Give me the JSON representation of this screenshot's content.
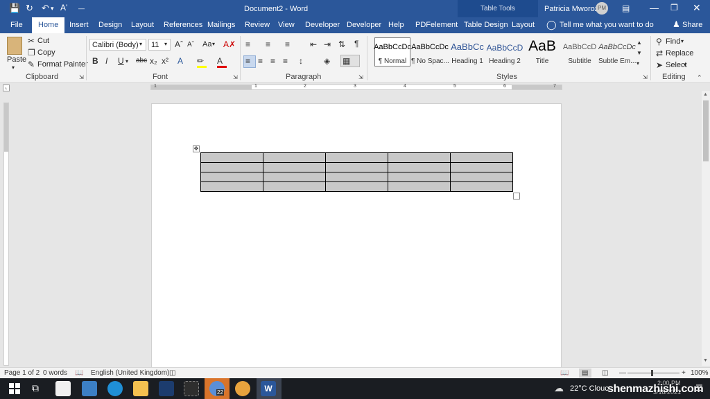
{
  "title_bar": {
    "document_title": "Document2 - Word",
    "context_label": "Table Tools",
    "user_name": "Patricia Mworozi",
    "user_initials": "PM"
  },
  "tabs": [
    "File",
    "Home",
    "Insert",
    "Design",
    "Layout",
    "References",
    "Mailings",
    "Review",
    "View",
    "Developer",
    "Developer",
    "Help",
    "PDFelement",
    "Table Design",
    "Layout"
  ],
  "active_tab": "Home",
  "tell_me": "Tell me what you want to do",
  "share_label": "Share",
  "clipboard": {
    "paste": "Paste",
    "cut": "Cut",
    "copy": "Copy",
    "format_painter": "Format Painter",
    "group_label": "Clipboard"
  },
  "font": {
    "name": "Calibri (Body)",
    "size": "11",
    "case_label": "Aa",
    "group_label": "Font"
  },
  "paragraph": {
    "group_label": "Paragraph"
  },
  "styles": {
    "items": [
      {
        "sample": "AaBbCcDc",
        "name": "¶ Normal"
      },
      {
        "sample": "AaBbCcDc",
        "name": "¶ No Spac..."
      },
      {
        "sample": "AaBbCc",
        "name": "Heading 1"
      },
      {
        "sample": "AaBbCcD",
        "name": "Heading 2"
      },
      {
        "sample": "AaB",
        "name": "Title"
      },
      {
        "sample": "AaBbCcD",
        "name": "Subtitle"
      },
      {
        "sample": "AaBbCcDc",
        "name": "Subtle Em..."
      }
    ],
    "group_label": "Styles"
  },
  "editing": {
    "find": "Find",
    "replace": "Replace",
    "select": "Select",
    "group_label": "Editing"
  },
  "ruler_numbers": [
    "1",
    "1",
    "2",
    "3",
    "4",
    "5",
    "6",
    "7"
  ],
  "table": {
    "rows": 4,
    "columns": 5
  },
  "status_bar": {
    "page": "Page 1 of 2",
    "words": "0 words",
    "language": "English (United Kingdom)",
    "zoom": "100%"
  },
  "taskbar": {
    "weather": "22°C  Clouc",
    "time": "2:00 PM",
    "date": "3/18/2021",
    "badge": "22",
    "watermark": "shenmazhishi.com"
  },
  "colors": {
    "word_blue": "#2b579a",
    "table_tools": "#1e4b8e",
    "table_fill": "#c8c8c8",
    "taskbar": "#1a1d22"
  }
}
